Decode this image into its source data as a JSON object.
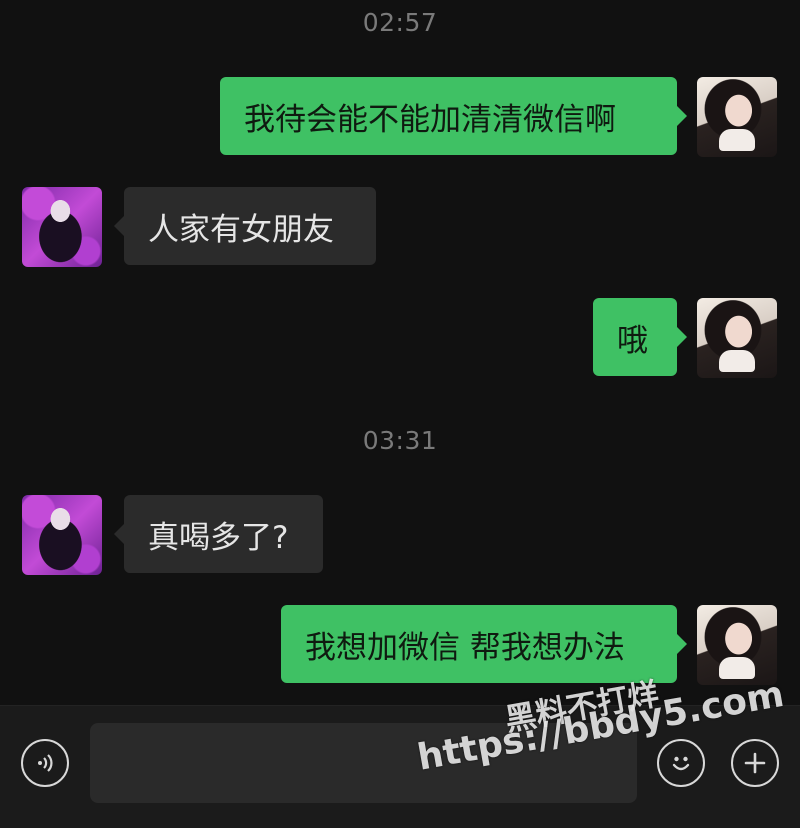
{
  "messages": [
    {
      "type": "timestamp",
      "text": "02:57"
    },
    {
      "type": "outgoing",
      "text": "我待会能不能加清清微信啊"
    },
    {
      "type": "incoming",
      "text": "人家有女朋友"
    },
    {
      "type": "outgoing",
      "text": "哦"
    },
    {
      "type": "timestamp",
      "text": "03:31"
    },
    {
      "type": "incoming",
      "text": "真喝多了?"
    },
    {
      "type": "outgoing",
      "text": "我想加微信 帮我想办法"
    }
  ],
  "input_bar": {
    "voice_icon": "voice-icon",
    "emoji_icon": "emoji-icon",
    "plus_icon": "plus-icon",
    "text_value": ""
  },
  "watermark": {
    "line1": "黑料不打烊",
    "line2": "https://bbdy5.com"
  },
  "colors": {
    "background": "#111111",
    "outgoing_bubble": "#3fc164",
    "incoming_bubble": "#2b2b2b",
    "input_bar": "#1b1b1b"
  }
}
